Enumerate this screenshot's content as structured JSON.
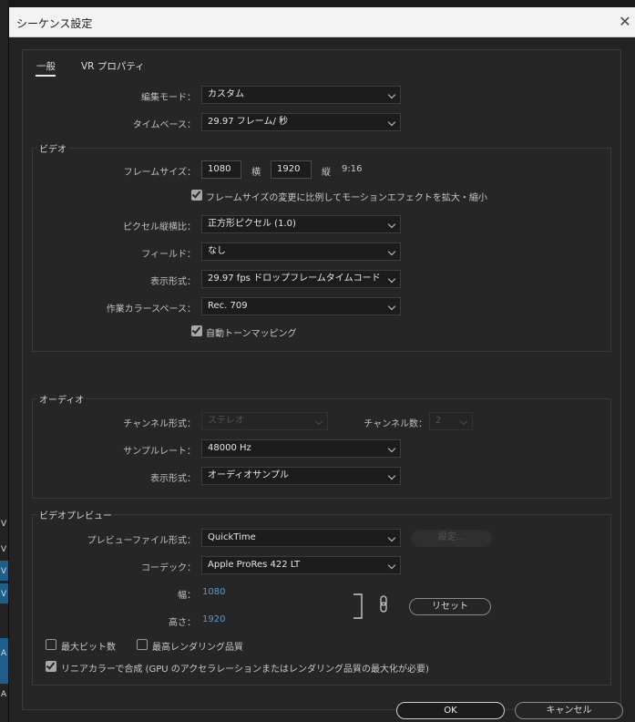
{
  "background": {
    "side_labels": [
      "V",
      "V",
      "V",
      "V",
      "V",
      "A",
      "A"
    ]
  },
  "dialog": {
    "title": "シーケンス設定",
    "close_glyph": "✕"
  },
  "tabs": [
    {
      "label": "一般",
      "active": true
    },
    {
      "label": "VR プロパティ",
      "active": false
    }
  ],
  "general": {
    "edit_mode": {
      "label": "編集モード：",
      "value": "カスタム"
    },
    "timebase": {
      "label": "タイムベース：",
      "value": "29.97  フレーム/ 秒"
    }
  },
  "video": {
    "group_label": "ビデオ",
    "frame_size": {
      "label": "フレームサイズ：",
      "width": "1080",
      "h_label": "横",
      "height": "1920",
      "v_label": "縦",
      "aspect": "9:16"
    },
    "scale_checkbox": {
      "label": "フレームサイズの変更に比例してモーションエフェクトを拡大・縮小",
      "checked": true
    },
    "pixel_aspect": {
      "label": "ピクセル縦横比：",
      "value": "正方形ピクセル (1.0)"
    },
    "fields": {
      "label": "フィールド：",
      "value": "なし"
    },
    "display_format": {
      "label": "表示形式：",
      "value": "29.97  fps ドロップフレームタイムコード"
    },
    "color_space": {
      "label": "作業カラースペース：",
      "value": "Rec. 709"
    },
    "tone_mapping": {
      "label": "自動トーンマッピング",
      "checked": true
    }
  },
  "audio": {
    "group_label": "オーディオ",
    "channel_format": {
      "label": "チャンネル形式：",
      "value": "ステレオ"
    },
    "channel_count": {
      "label": "チャンネル数：",
      "value": "2"
    },
    "sample_rate": {
      "label": "サンプルレート：",
      "value": "48000 Hz"
    },
    "display_format": {
      "label": "表示形式：",
      "value": "オーディオサンプル"
    }
  },
  "preview": {
    "group_label": "ビデオプレビュー",
    "file_format": {
      "label": "プレビューファイル形式：",
      "value": "QuickTime"
    },
    "settings_button": "設定...",
    "codec": {
      "label": "コーデック：",
      "value": "Apple ProRes 422 LT"
    },
    "width": {
      "label": "幅：",
      "value": "1080"
    },
    "height": {
      "label": "高さ：",
      "value": "1920"
    },
    "reset_button": "リセット",
    "max_bit_depth": {
      "label": "最大ビット数",
      "checked": false
    },
    "max_render_quality": {
      "label": "最高レンダリング品質",
      "checked": false
    },
    "linear_color": {
      "label": "リニアカラーで合成 (GPU のアクセラレーションまたはレンダリング品質の最大化が必要)",
      "checked": true
    }
  },
  "footer": {
    "ok": "OK",
    "cancel": "キャンセル"
  },
  "colors": {
    "accent_value": "#4a9ee0",
    "dialog_bg": "#232323",
    "panel_bg": "#262626",
    "titlebar_bg": "#f3f3f3"
  }
}
